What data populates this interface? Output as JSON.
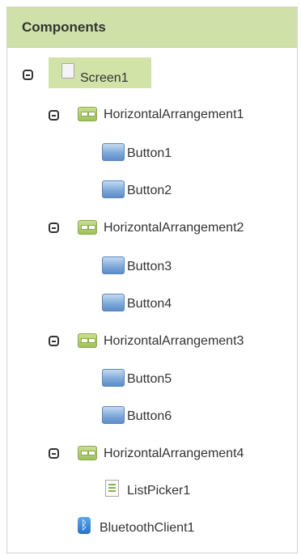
{
  "header": {
    "title": "Components"
  },
  "tree": {
    "screen": {
      "label": "Screen1"
    },
    "arrangement1": {
      "label": "HorizontalArrangement1"
    },
    "button1": {
      "label": "Button1"
    },
    "button2": {
      "label": "Button2"
    },
    "arrangement2": {
      "label": "HorizontalArrangement2"
    },
    "button3": {
      "label": "Button3"
    },
    "button4": {
      "label": "Button4"
    },
    "arrangement3": {
      "label": "HorizontalArrangement3"
    },
    "button5": {
      "label": "Button5"
    },
    "button6": {
      "label": "Button6"
    },
    "arrangement4": {
      "label": "HorizontalArrangement4"
    },
    "listpicker": {
      "label": "ListPicker1"
    },
    "bluetooth": {
      "label": "BluetoothClient1"
    }
  },
  "icons": {
    "collapse": "collapse-icon",
    "screen": "screen-icon",
    "arrangement": "horizontal-arrangement-icon",
    "button": "button-icon",
    "listpicker": "listpicker-icon",
    "bluetooth": "bluetooth-icon"
  },
  "colors": {
    "header_bg": "#cfe0a9",
    "selection_bg": "#d2e3a8",
    "text": "#333333"
  }
}
